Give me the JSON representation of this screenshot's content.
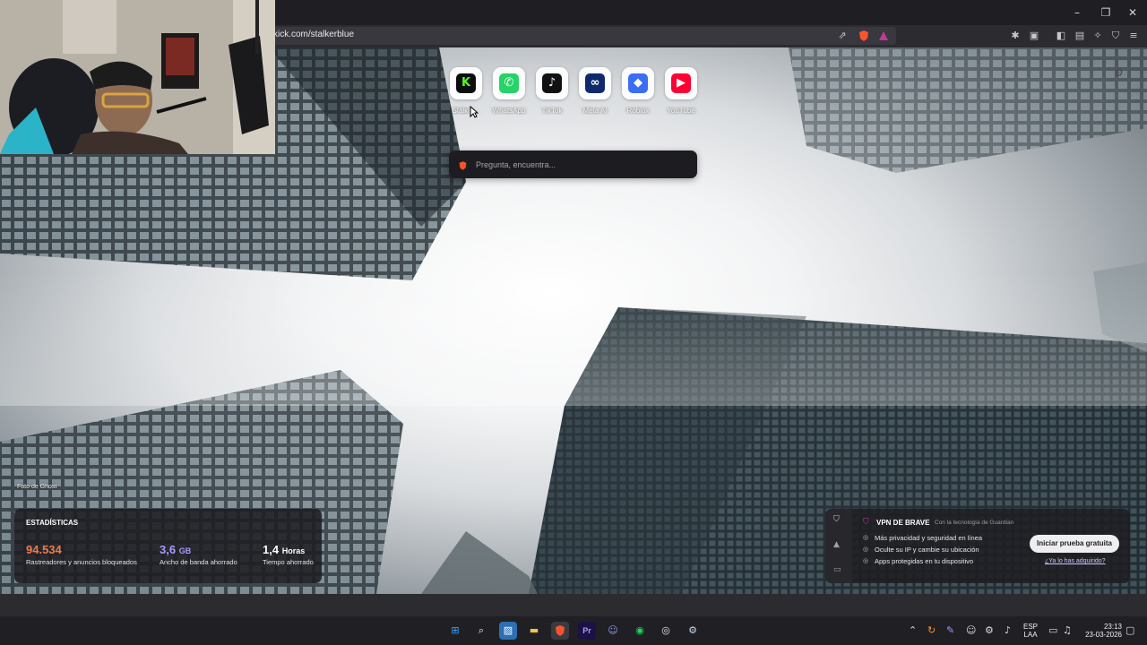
{
  "browser": {
    "url": "kick.com/stalkerblue",
    "window_controls": {
      "minimize": "–",
      "restore": "❐",
      "close": "✕"
    }
  },
  "top_sites": [
    {
      "label": "Stalker...",
      "icon": "kick-icon",
      "glyph": "K",
      "color": "#53fc18",
      "bg": "#0b0e0f"
    },
    {
      "label": "WhatsApp",
      "icon": "whatsapp-icon",
      "glyph": "✆",
      "color": "#ffffff",
      "bg": "#25d366"
    },
    {
      "label": "TikTok",
      "icon": "tiktok-icon",
      "glyph": "♪",
      "color": "#ffffff",
      "bg": "#111111"
    },
    {
      "label": "Meta AI",
      "icon": "meta-icon",
      "glyph": "∞",
      "color": "#ffffff",
      "bg": "#0f2a6b"
    },
    {
      "label": "Roblox",
      "icon": "roblox-icon",
      "glyph": "◆",
      "color": "#ffffff",
      "bg": "#3b6df5"
    },
    {
      "label": "YouTube",
      "icon": "youtube-icon",
      "glyph": "▶",
      "color": "#ffffff",
      "bg": "#ff0033"
    }
  ],
  "search": {
    "placeholder": "Pregunta, encuentra..."
  },
  "photo_credit": "Foto de Ghost",
  "stats": {
    "title": "ESTADÍSTICAS",
    "trackers": {
      "value": "94.534",
      "label": "Rastreadores y anuncios bloqueados",
      "color": "#f37b4a"
    },
    "bandwidth": {
      "value": "3,6",
      "unit": "GB",
      "label": "Ancho de banda ahorrado",
      "color": "#a89bff"
    },
    "time": {
      "value": "1,4",
      "unit": "Horas",
      "label": "Tiempo ahorrado",
      "color": "#ffffff"
    }
  },
  "vpn": {
    "title": "VPN DE BRAVE",
    "subtitle": "Con la tecnología de Guardian",
    "items": [
      "Más privacidad y seguridad en línea",
      "Oculte su IP y cambie su ubicación",
      "Apps protegidas en tu dispositivo"
    ],
    "button": "Iniciar prueba gratuita",
    "link": "¿Ya lo has adquirido?"
  },
  "taskbar": {
    "lang_line1": "ESP",
    "lang_line2": "LAA",
    "time": "23:13",
    "date": "23-03-2026"
  }
}
